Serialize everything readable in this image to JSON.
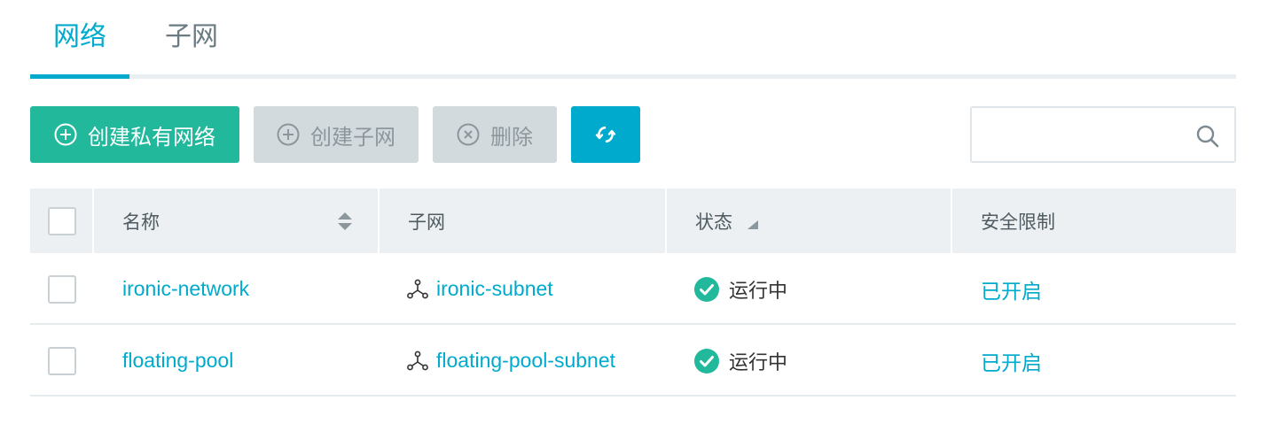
{
  "tabs": [
    {
      "label": "网络",
      "active": true
    },
    {
      "label": "子网",
      "active": false
    }
  ],
  "toolbar": {
    "create_network_label": "创建私有网络",
    "create_subnet_label": "创建子网",
    "delete_label": "删除",
    "refresh_icon": "refresh-icon"
  },
  "search": {
    "placeholder": "",
    "value": ""
  },
  "table": {
    "headers": {
      "name": "名称",
      "subnet": "子网",
      "status": "状态",
      "security": "安全限制"
    },
    "rows": [
      {
        "name": "ironic-network",
        "subnet": "ironic-subnet",
        "status": "运行中",
        "security": "已开启"
      },
      {
        "name": "floating-pool",
        "subnet": "floating-pool-subnet",
        "status": "运行中",
        "security": "已开启"
      }
    ]
  },
  "colors": {
    "accent": "#00aacc",
    "primary_button": "#21b89c",
    "disabled_button": "#d3dade",
    "status_ok": "#21b89c"
  }
}
